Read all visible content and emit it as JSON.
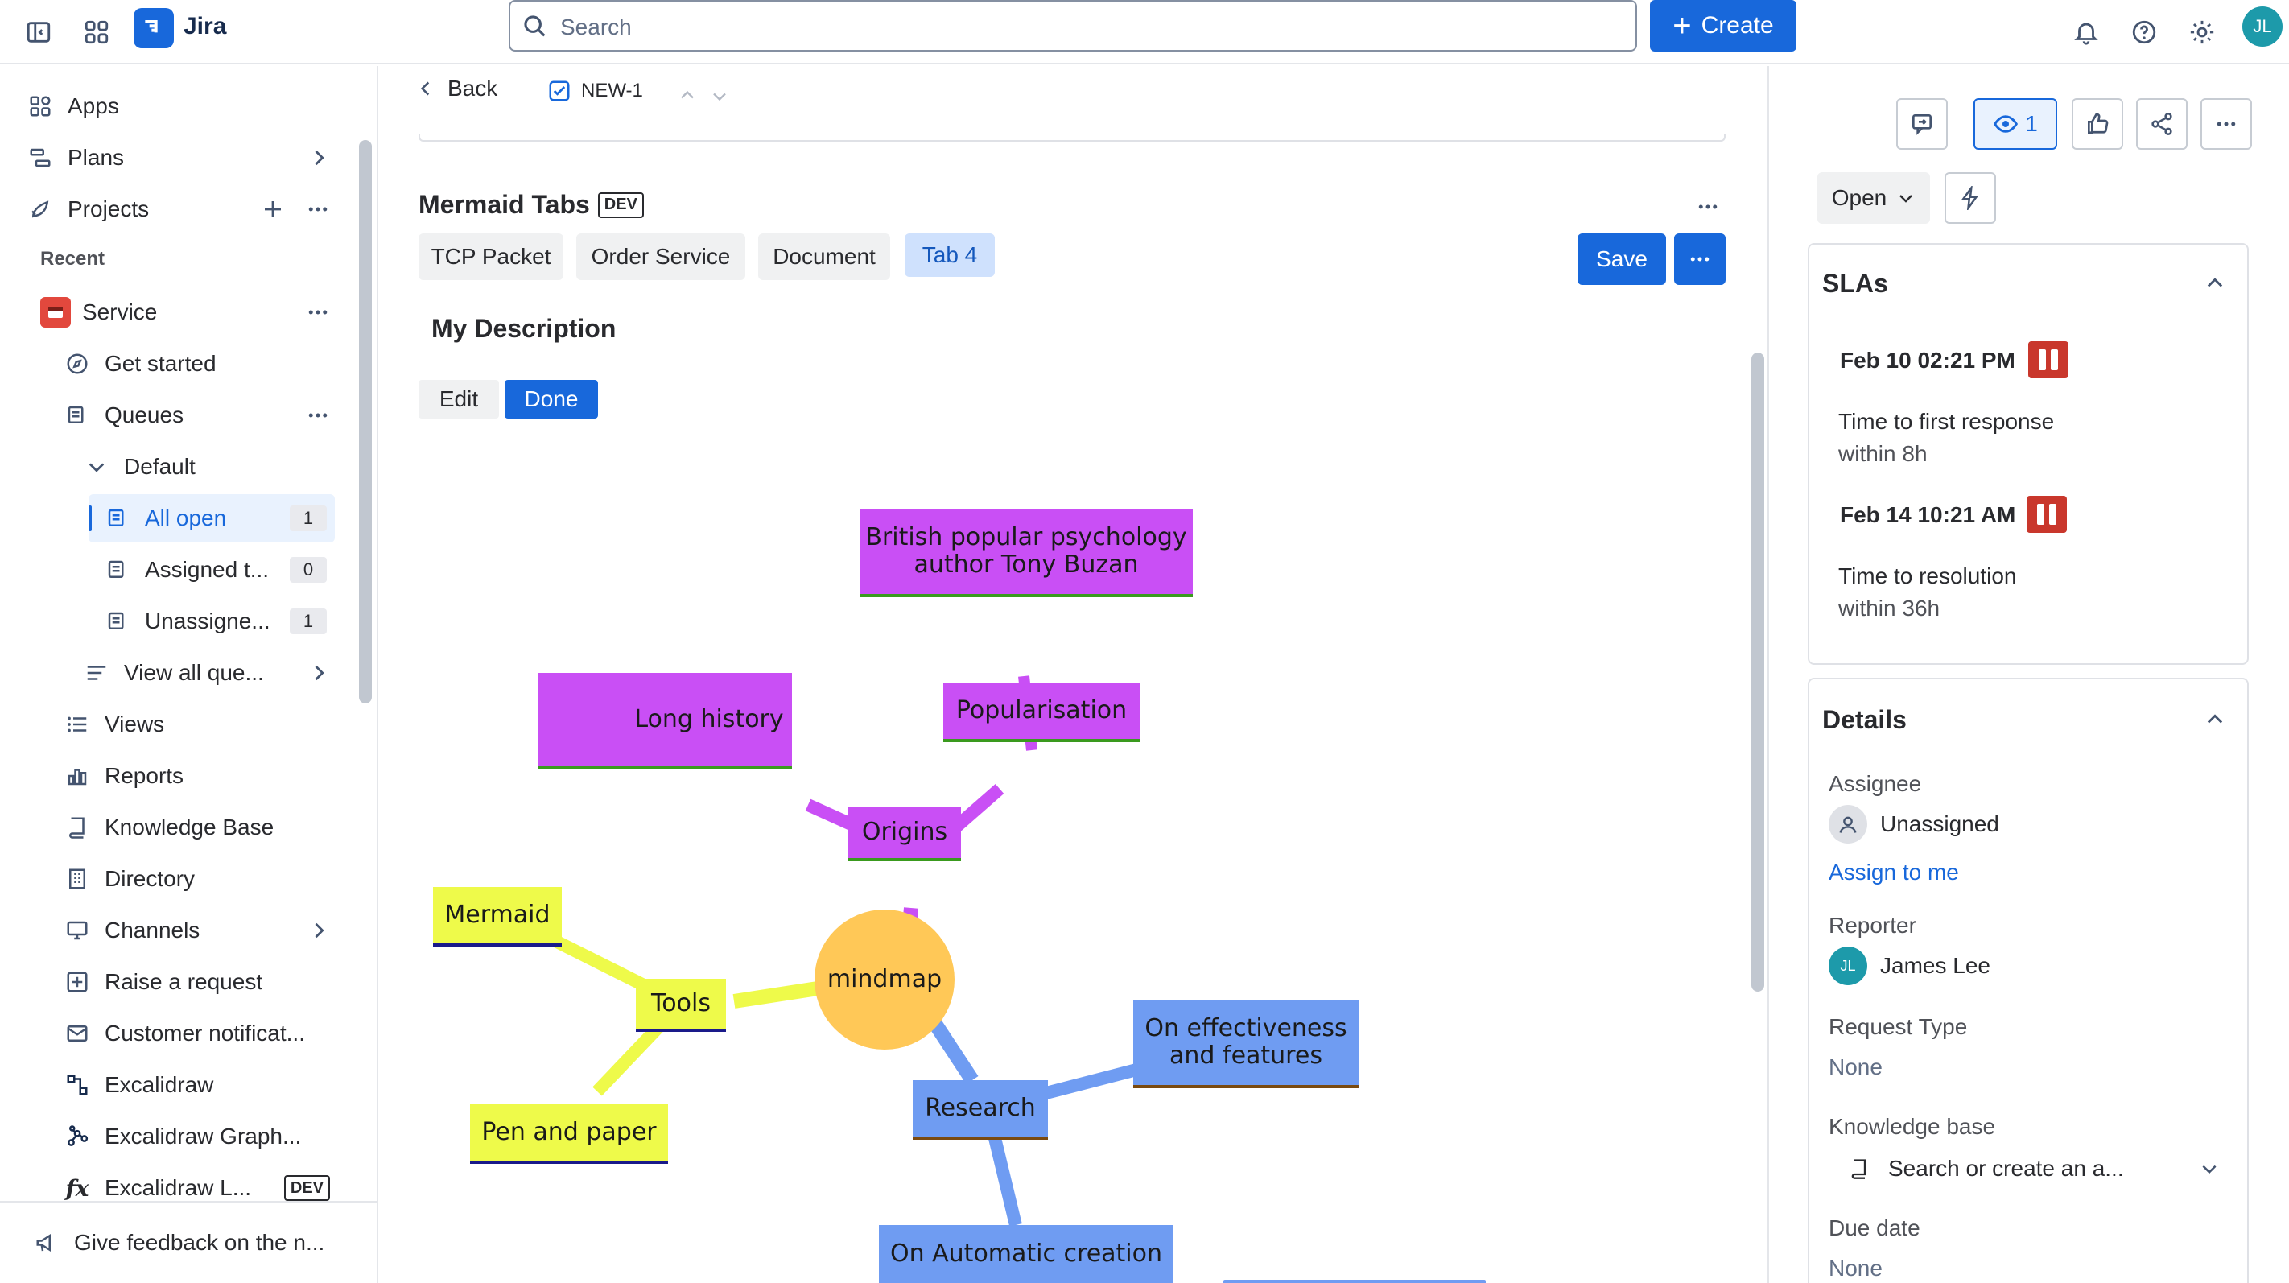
{
  "topbar": {
    "app_name": "Jira",
    "search_placeholder": "Search",
    "create_label": "Create",
    "avatar_initials": "JL"
  },
  "sidebar": {
    "apps": "Apps",
    "plans": "Plans",
    "projects": "Projects",
    "recent": "Recent",
    "service": "Service",
    "get_started": "Get started",
    "queues": "Queues",
    "default": "Default",
    "all_open": "All open",
    "all_open_count": "1",
    "assigned": "Assigned t...",
    "assigned_count": "0",
    "unassigned": "Unassigne...",
    "unassigned_count": "1",
    "view_all_queues": "View all que...",
    "views": "Views",
    "reports": "Reports",
    "knowledge_base": "Knowledge Base",
    "directory": "Directory",
    "channels": "Channels",
    "raise_request": "Raise a request",
    "customer_notif": "Customer notificat...",
    "excalidraw": "Excalidraw",
    "excalidraw_graph": "Excalidraw Graph...",
    "excalidraw_l": "Excalidraw L...",
    "dev_badge": "DEV",
    "feedback": "Give feedback on the n..."
  },
  "issue": {
    "back": "Back",
    "key": "NEW-1",
    "title": "Mermaid Tabs",
    "dev_badge": "DEV",
    "tabs": [
      "TCP Packet",
      "Order Service",
      "Document",
      "Tab 4"
    ],
    "active_tab": "Tab 4",
    "save": "Save",
    "description_heading": "My Description",
    "edit": "Edit",
    "done": "Done"
  },
  "mindmap": {
    "root": "mindmap",
    "origins": "Origins",
    "long_history": "Long history",
    "popularisation": "Popularisation",
    "buzan_line1": "British popular psychology",
    "buzan_line2": "author Tony Buzan",
    "tools": "Tools",
    "mermaid": "Mermaid",
    "pen_paper": "Pen and paper",
    "research": "Research",
    "effectiveness_line1": "On effectiveness",
    "effectiveness_line2": "and features",
    "automatic": "On Automatic creation",
    "colors": {
      "root": "#ffc857",
      "purple": "#c94ff5",
      "yellow": "#eefa4a",
      "blue": "#6f9cf2"
    }
  },
  "right_panel": {
    "watch_count": "1",
    "status": "Open",
    "slas": {
      "title": "SLAs",
      "items": [
        {
          "date": "Feb 10 02:21 PM",
          "name": "Time to first response",
          "target": "within 8h"
        },
        {
          "date": "Feb 14 10:21 AM",
          "name": "Time to resolution",
          "target": "within 36h"
        }
      ]
    },
    "details": {
      "title": "Details",
      "assignee_label": "Assignee",
      "assignee_value": "Unassigned",
      "assign_to_me": "Assign to me",
      "reporter_label": "Reporter",
      "reporter_value": "James Lee",
      "reporter_initials": "JL",
      "request_type_label": "Request Type",
      "request_type_value": "None",
      "knowledge_base_label": "Knowledge base",
      "knowledge_base_placeholder": "Search or create an a...",
      "due_date_label": "Due date",
      "due_date_value": "None"
    }
  }
}
